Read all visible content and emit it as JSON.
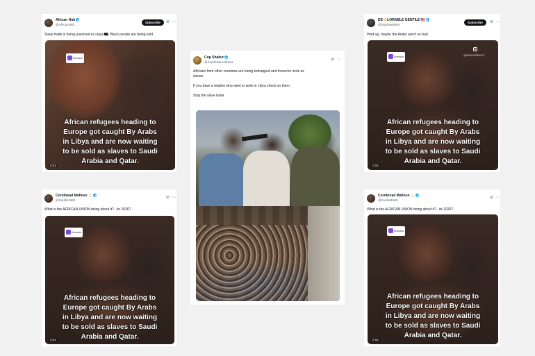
{
  "posts": {
    "p1": {
      "name": "African Hub",
      "handle": "@AfricanHub_",
      "subscribe": "Subscribe",
      "text": "Slave trade is being practiced in Libya 🇱🇾. Black people are being sold",
      "overlay": [
        "African refugees heading to",
        "Europe got caught By Arabs",
        "in Libya and are now waiting",
        "to be sold as slaves to Saudi",
        "Arabia and Qatar."
      ],
      "time": "0:03",
      "app_label": "Dramabox"
    },
    "p2": {
      "name": "Cop Shakur",
      "handle": "@CopShakurAkhara",
      "text_lines": [
        "Africans from other countries are being kidnapped and forced to work as",
        "slaves.",
        "",
        "If you have a relative who went to work in Libya check on them.",
        "",
        "Stop the slave trade"
      ]
    },
    "p3": {
      "name": "DE🔆LORABLE GENTILE 🇺🇸",
      "handle": "@Deplorable94",
      "subscribe": "Subscribe",
      "text": "Hold up, maybe the Arabs aren't so bad",
      "overlay": [
        "African refugees heading to",
        "Europe got caught By Arabs",
        "in Libya and are now waiting",
        "to be sold as slaves to Saudi",
        "Arabia and Qatar."
      ],
      "time": "0:04",
      "app_label": "Dramabox",
      "watermark": "@SURVIVOREALITY"
    },
    "p4": {
      "name": "Cornbread Mafioso 🕯️",
      "handle": "@Soulful1665",
      "text": "What is the AFRICAN UNION doing about it?...its 2026?",
      "overlay": [
        "African refugees heading to",
        "Europe got caught By Arabs",
        "in Libya and are now waiting",
        "to be sold as slaves to Saudi",
        "Arabia and Qatar."
      ],
      "time": "0:04",
      "app_label": "Dramabox"
    },
    "p5": {
      "name": "Cornbread Mafioso 🕯️",
      "handle": "@Soulful1665",
      "text": "What is the AFRICAN UNION doing about it?...its 2026?",
      "overlay": [
        "African refugees heading to",
        "Europe got caught By Arabs",
        "in Libya and are now waiting",
        "to be sold as slaves to Saudi",
        "Arabia and Qatar."
      ],
      "time": "0:04",
      "app_label": "Dramabox"
    }
  },
  "icons": {
    "grok": "grok-icon",
    "more": "more-icon",
    "verified": "verified-badge-icon"
  },
  "colors": {
    "background": "#f1f1f1",
    "card": "#ffffff",
    "verified": "#1d9bf0",
    "subscribe_bg": "#0f1419"
  }
}
